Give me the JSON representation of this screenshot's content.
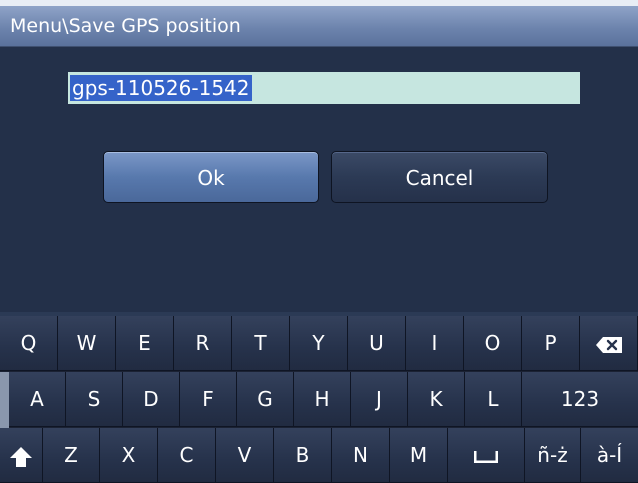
{
  "title": "Menu\\Save GPS position",
  "name_input": {
    "value": "gps-110526-1542"
  },
  "buttons": {
    "ok_label": "Ok",
    "cancel_label": "Cancel"
  },
  "keyboard": {
    "row1": [
      "Q",
      "W",
      "E",
      "R",
      "T",
      "Y",
      "U",
      "I",
      "O",
      "P"
    ],
    "row2": [
      "A",
      "S",
      "D",
      "F",
      "G",
      "H",
      "J",
      "K",
      "L"
    ],
    "row2_mode_label": "123",
    "row3": [
      "Z",
      "X",
      "C",
      "V",
      "B",
      "N",
      "M"
    ],
    "row3_special_label": "ñ-ż",
    "row3_accent_label": "à-Í",
    "icons": {
      "backspace": "backspace-icon",
      "shift": "shift-icon",
      "space": "space-icon"
    }
  },
  "colors": {
    "title_bar": "#6d84ad",
    "background": "#233049",
    "input_fill": "#c6e6e0",
    "selection": "#3563c9",
    "ok_button": "#5879ad",
    "cancel_button": "#2c3a55"
  }
}
